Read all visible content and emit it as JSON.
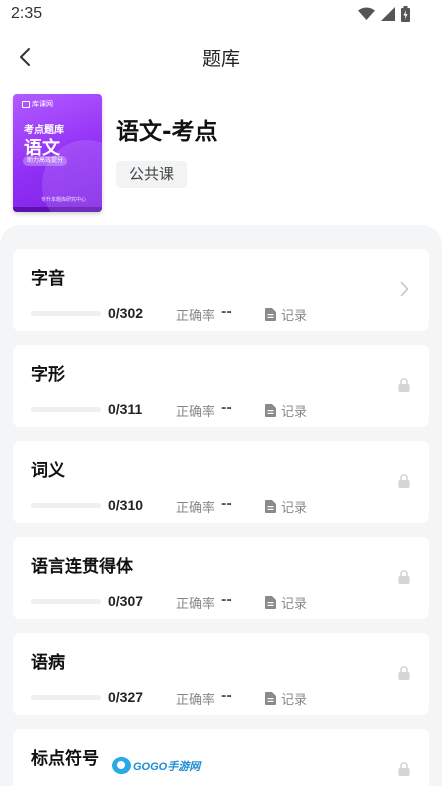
{
  "status_bar": {
    "time": "2:35"
  },
  "nav": {
    "title": "题库"
  },
  "header": {
    "cover": {
      "brand": "库课网",
      "title_line1": "考点题库",
      "title_line2": "语文",
      "pill": "助力高效提分",
      "footer": "专升本题库研究中心"
    },
    "subject_title": "语文-考点",
    "tag": "公共课"
  },
  "labels": {
    "accuracy": "正确率",
    "record": "记录"
  },
  "topics": [
    {
      "title": "字音",
      "progress_text": "0/302",
      "answered": 0,
      "total": 302,
      "accuracy": "--",
      "state": "unlocked"
    },
    {
      "title": "字形",
      "progress_text": "0/311",
      "answered": 0,
      "total": 311,
      "accuracy": "--",
      "state": "locked"
    },
    {
      "title": "词义",
      "progress_text": "0/310",
      "answered": 0,
      "total": 310,
      "accuracy": "--",
      "state": "locked"
    },
    {
      "title": "语言连贯得体",
      "progress_text": "0/307",
      "answered": 0,
      "total": 307,
      "accuracy": "--",
      "state": "locked"
    },
    {
      "title": "语病",
      "progress_text": "0/327",
      "answered": 0,
      "total": 327,
      "accuracy": "--",
      "state": "locked"
    },
    {
      "title": "标点符号",
      "progress_text": "",
      "answered": 0,
      "total": 0,
      "accuracy": "",
      "state": "locked"
    }
  ],
  "watermark": {
    "text": "GOGO手游网"
  },
  "colors": {
    "accent": "#8a2cf2",
    "background": "#f4f5f7",
    "card": "#ffffff"
  }
}
